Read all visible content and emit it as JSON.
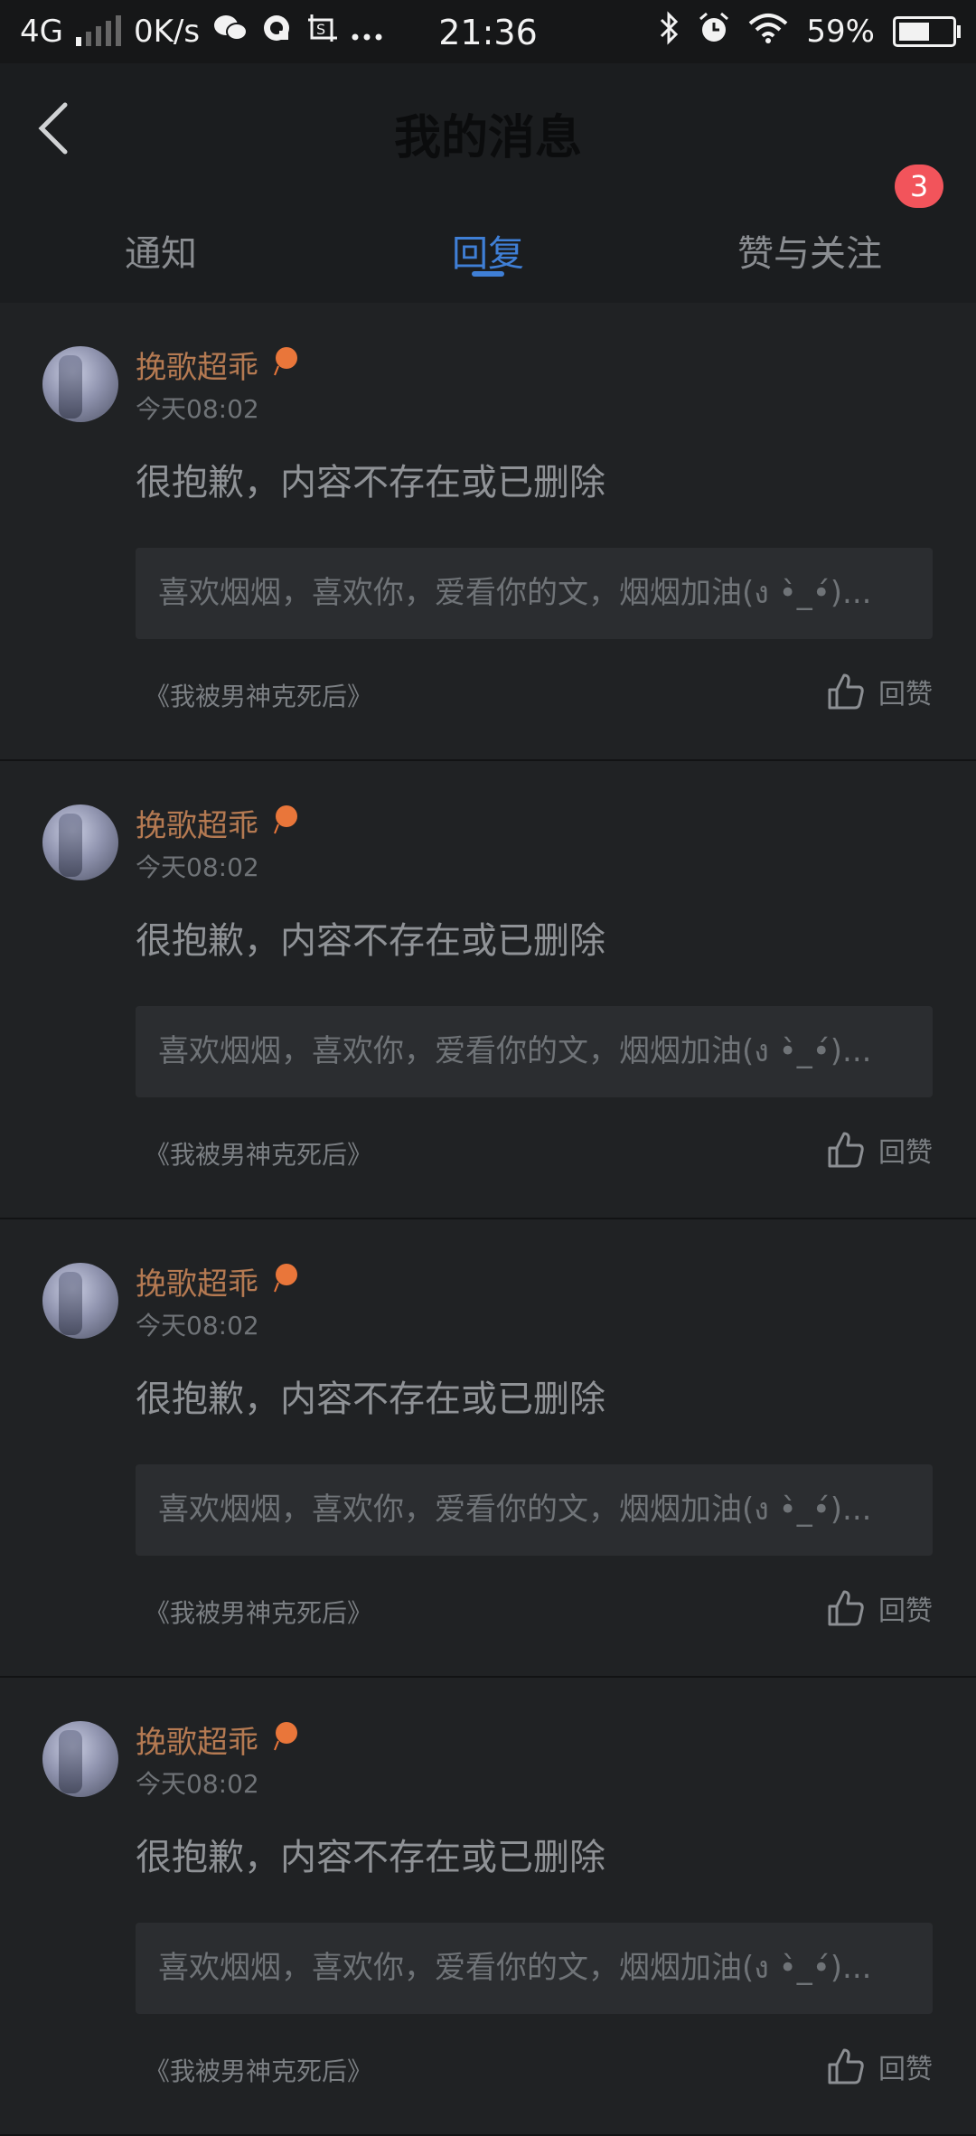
{
  "status_bar": {
    "network": "4G",
    "speed": "0K/s",
    "time": "21:36",
    "battery": "59%",
    "battery_level": 0.59,
    "icons": [
      "wechat-icon",
      "qq-icon",
      "screenshot-icon",
      "more-icon",
      "bluetooth-icon",
      "alarm-icon",
      "wifi-icon",
      "battery-icon"
    ]
  },
  "header": {
    "title": "我的消息"
  },
  "tabs": [
    {
      "label": "通知"
    },
    {
      "label": "回复",
      "active": true
    },
    {
      "label": "赞与关注",
      "badge": "3"
    }
  ],
  "messages": [
    {
      "username": "挽歌超乖",
      "time": "今天08:02",
      "content": "很抱歉，内容不存在或已删除",
      "quote": "喜欢烟烟，喜欢你，爱看你的文，烟烟加油(ง •̀_•́)...",
      "book": "《我被男神克死后》",
      "action": "回赞"
    },
    {
      "username": "挽歌超乖",
      "time": "今天08:02",
      "content": "很抱歉，内容不存在或已删除",
      "quote": "喜欢烟烟，喜欢你，爱看你的文，烟烟加油(ง •̀_•́)...",
      "book": "《我被男神克死后》",
      "action": "回赞"
    },
    {
      "username": "挽歌超乖",
      "time": "今天08:02",
      "content": "很抱歉，内容不存在或已删除",
      "quote": "喜欢烟烟，喜欢你，爱看你的文，烟烟加油(ง •̀_•́)...",
      "book": "《我被男神克死后》",
      "action": "回赞"
    },
    {
      "username": "挽歌超乖",
      "time": "今天08:02",
      "content": "很抱歉，内容不存在或已删除",
      "quote": "喜欢烟烟，喜欢你，爱看你的文，烟烟加油(ง •̀_•́)...",
      "book": "《我被男神克死后》",
      "action": "回赞"
    }
  ]
}
